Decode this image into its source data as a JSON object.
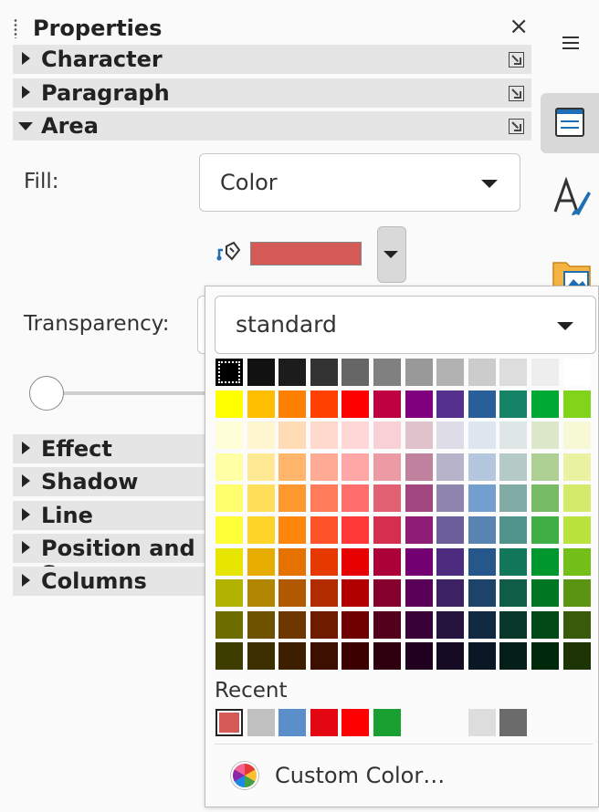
{
  "panel": {
    "title": "Properties",
    "close_glyph": "×",
    "sections_top": [
      {
        "label": "Character",
        "expanded": false
      },
      {
        "label": "Paragraph",
        "expanded": false
      },
      {
        "label": "Area",
        "expanded": true
      }
    ],
    "sections_bottom": [
      {
        "label": "Effect"
      },
      {
        "label": "Shadow"
      },
      {
        "label": "Line"
      },
      {
        "label": "Position and S"
      },
      {
        "label": "Columns"
      }
    ]
  },
  "area": {
    "fill_label": "Fill:",
    "fill_value": "Color",
    "fill_color": "#d45a55",
    "transparency_label": "Transparency:"
  },
  "tabbar": {
    "icons": [
      "menu-icon",
      "properties-icon",
      "styles-icon",
      "gallery-icon"
    ]
  },
  "color_popup": {
    "palette_value": "standard",
    "palette_rows": [
      [
        "#000000",
        "#111111",
        "#1c1c1c",
        "#333333",
        "#666666",
        "#808080",
        "#999999",
        "#b2b2b2",
        "#cccccc",
        "#dddddd",
        "#eeeeee",
        "#ffffff"
      ],
      [
        "#ffff00",
        "#ffbf00",
        "#ff8000",
        "#ff4000",
        "#ff0000",
        "#bf0041",
        "#800080",
        "#55308d",
        "#2a6099",
        "#158466",
        "#00a933",
        "#81d41a"
      ],
      [
        "#ffffd7",
        "#fff5ce",
        "#ffdbb6",
        "#ffd8ce",
        "#ffd7d7",
        "#f7d1d5",
        "#e0c2cd",
        "#dedce6",
        "#dee6ef",
        "#dee7e5",
        "#dde8cb",
        "#f6f9d4"
      ],
      [
        "#ffffa6",
        "#ffe994",
        "#ffb66c",
        "#ffaa95",
        "#ffa6a6",
        "#ec9ba4",
        "#bf819e",
        "#b7b3ca",
        "#b4c7dc",
        "#b3cac7",
        "#afd095",
        "#e8f2a1"
      ],
      [
        "#ffff6d",
        "#ffde59",
        "#ff972f",
        "#ff7b59",
        "#ff6d6d",
        "#e16173",
        "#a1467e",
        "#8e86ae",
        "#729fcf",
        "#81aca6",
        "#77bc65",
        "#d4ea6b"
      ],
      [
        "#ffff38",
        "#ffd428",
        "#ff860d",
        "#ff5429",
        "#ff3838",
        "#d62e4e",
        "#8d1d75",
        "#6b5e9b",
        "#5983b0",
        "#50938a",
        "#3faf46",
        "#bbe33d"
      ],
      [
        "#e6e600",
        "#e6ac00",
        "#e67300",
        "#e63900",
        "#e60000",
        "#ac0039",
        "#730073",
        "#4d2b7f",
        "#26578a",
        "#13775c",
        "#00982e",
        "#73bf17"
      ],
      [
        "#b2b200",
        "#b28600",
        "#b25900",
        "#b22c00",
        "#b20000",
        "#86002d",
        "#590059",
        "#3c2163",
        "#1d436b",
        "#0f5c47",
        "#007623",
        "#5a9411"
      ],
      [
        "#6e6e00",
        "#6e5200",
        "#6e3700",
        "#6e1b00",
        "#6e0000",
        "#52001c",
        "#370037",
        "#25143d",
        "#122942",
        "#09382b",
        "#004916",
        "#375b0a"
      ],
      [
        "#3d3d00",
        "#3d2e00",
        "#3d1f00",
        "#3d0f00",
        "#3d0000",
        "#2e000f",
        "#1f001f",
        "#150b22",
        "#0a1725",
        "#051f18",
        "#00290c",
        "#1e3306"
      ]
    ],
    "recent_label": "Recent",
    "recent_colors": [
      "#d45a55",
      "#c0c0c0",
      "#5b8fc9",
      "#e30613",
      "#ff0000",
      "#1aa030",
      "",
      "",
      "#dddddd",
      "#6b6b6b"
    ],
    "custom_color_label": "Custom Color…"
  }
}
